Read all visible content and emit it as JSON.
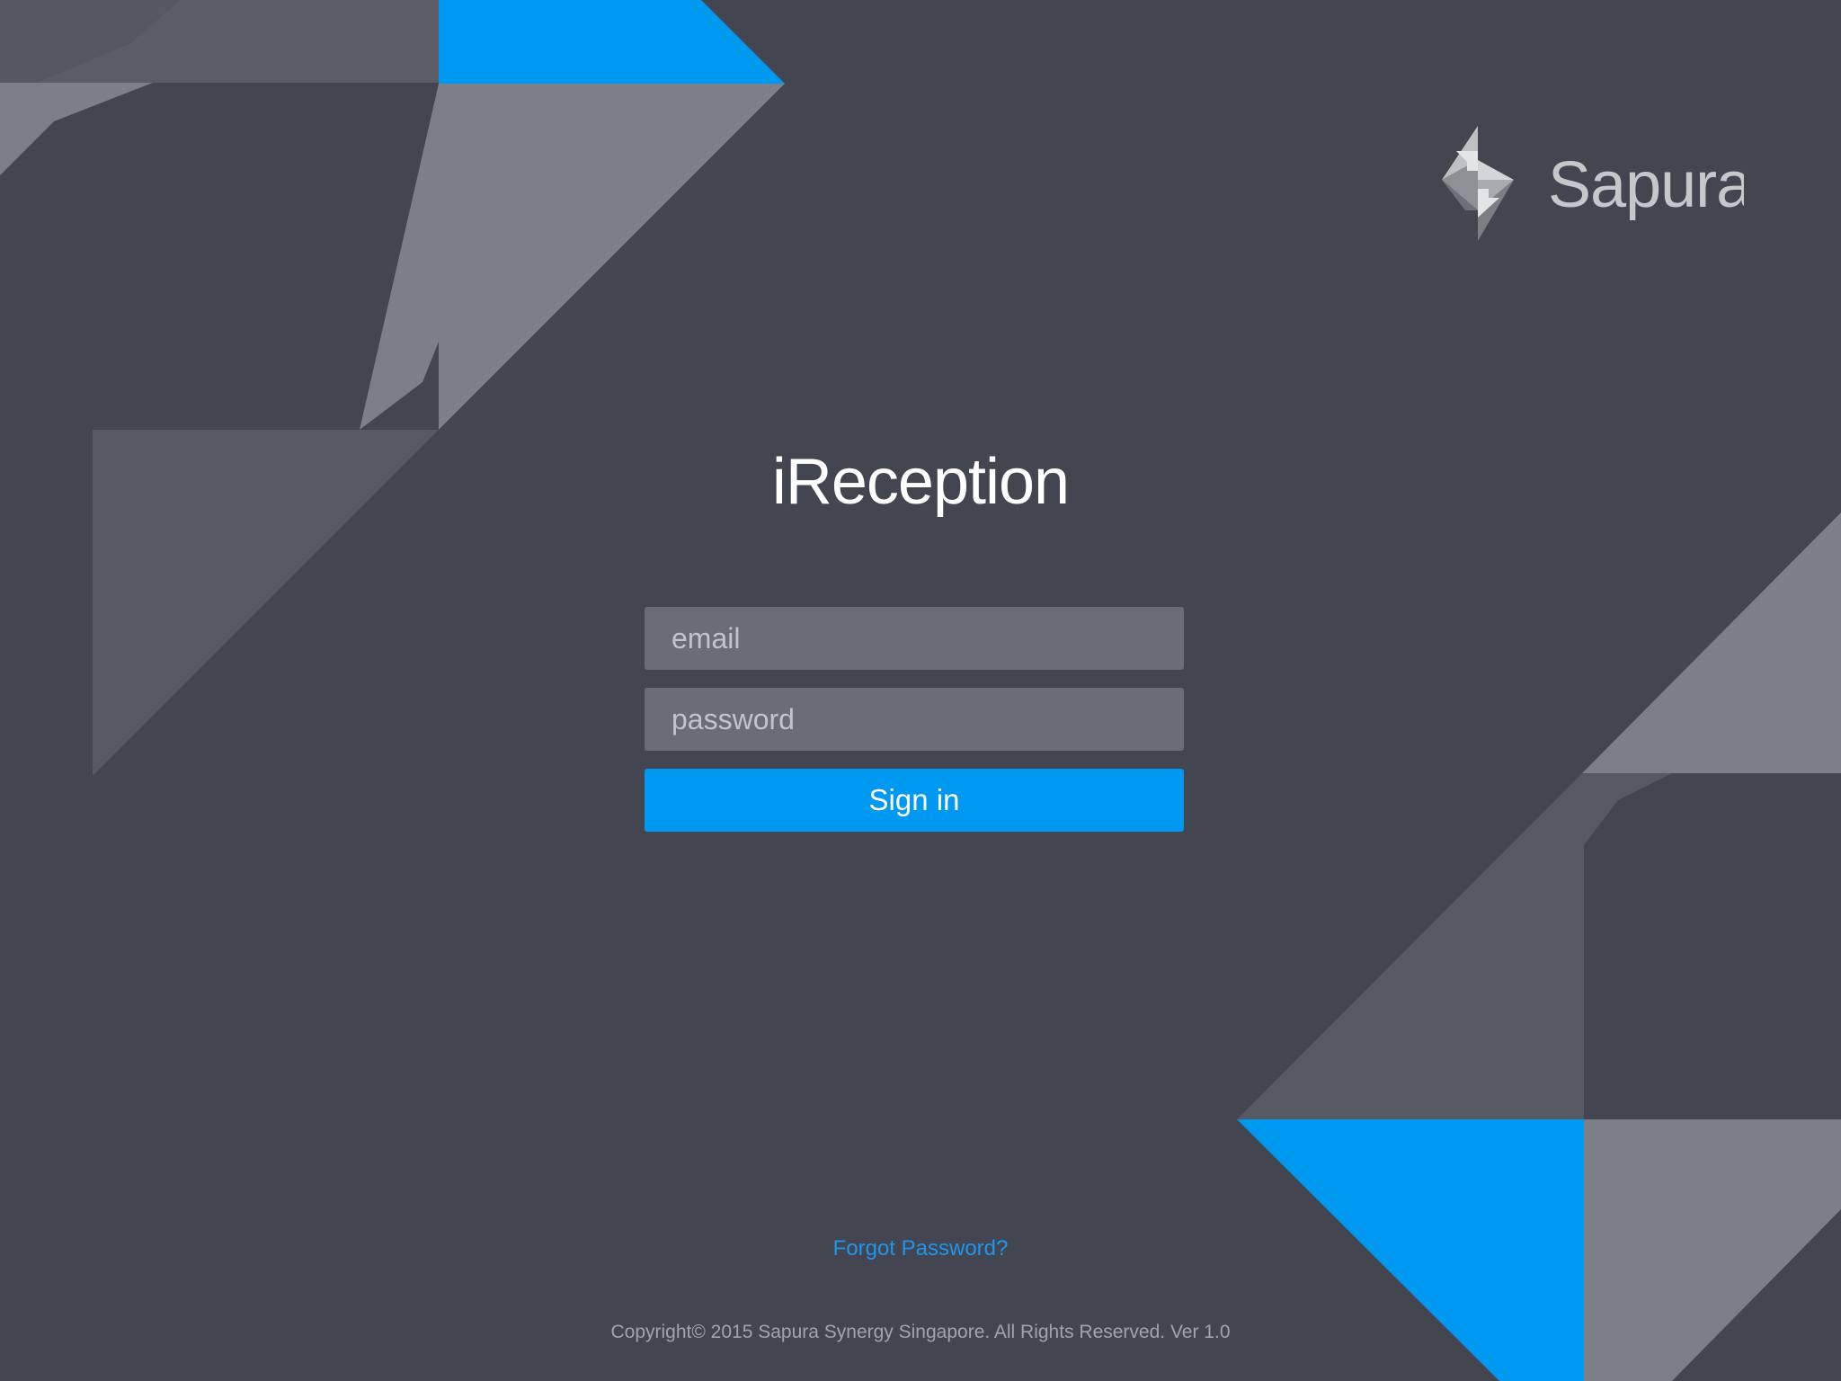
{
  "app": {
    "title": "iReception"
  },
  "brand": {
    "logo_text": "Sapura",
    "logo_icon": "sapura-diamond-logo"
  },
  "form": {
    "email_placeholder": "email",
    "email_value": "",
    "password_placeholder": "password",
    "password_value": "",
    "signin_label": "Sign in"
  },
  "footer": {
    "forgot_password": "Forgot Password?",
    "copyright": "Copyright© 2015 Sapura Synergy Singapore. All Rights Reserved. Ver 1.0"
  },
  "colors": {
    "background": "#434651",
    "accent_blue": "#0099f2",
    "field_bg": "#6a6c76",
    "link_blue": "#1e96f0"
  }
}
